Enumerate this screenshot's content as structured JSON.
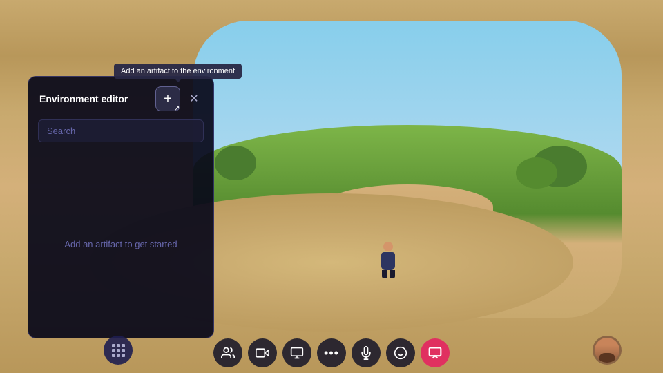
{
  "scene": {
    "background_color": "#c8a96e"
  },
  "tooltip": {
    "text": "Add an artifact to the environment"
  },
  "panel": {
    "title": "Environment editor",
    "search_placeholder": "Search",
    "empty_message": "Add an artifact to get started",
    "add_button_label": "+",
    "close_button_label": "✕"
  },
  "toolbar": {
    "buttons": [
      {
        "id": "people",
        "icon": "👥",
        "label": "People",
        "active": false
      },
      {
        "id": "camera",
        "icon": "🎥",
        "label": "Camera",
        "active": false
      },
      {
        "id": "screen",
        "icon": "🖥",
        "label": "Screen share",
        "active": false
      },
      {
        "id": "more",
        "icon": "•••",
        "label": "More",
        "active": false
      },
      {
        "id": "mic",
        "icon": "🎤",
        "label": "Microphone",
        "active": false
      },
      {
        "id": "emoji",
        "icon": "🙂",
        "label": "Emoji",
        "active": false
      },
      {
        "id": "share",
        "icon": "⬆",
        "label": "Share",
        "active": true,
        "red": true
      }
    ],
    "grid_icon": "grid",
    "avatar_icon": "avatar"
  }
}
